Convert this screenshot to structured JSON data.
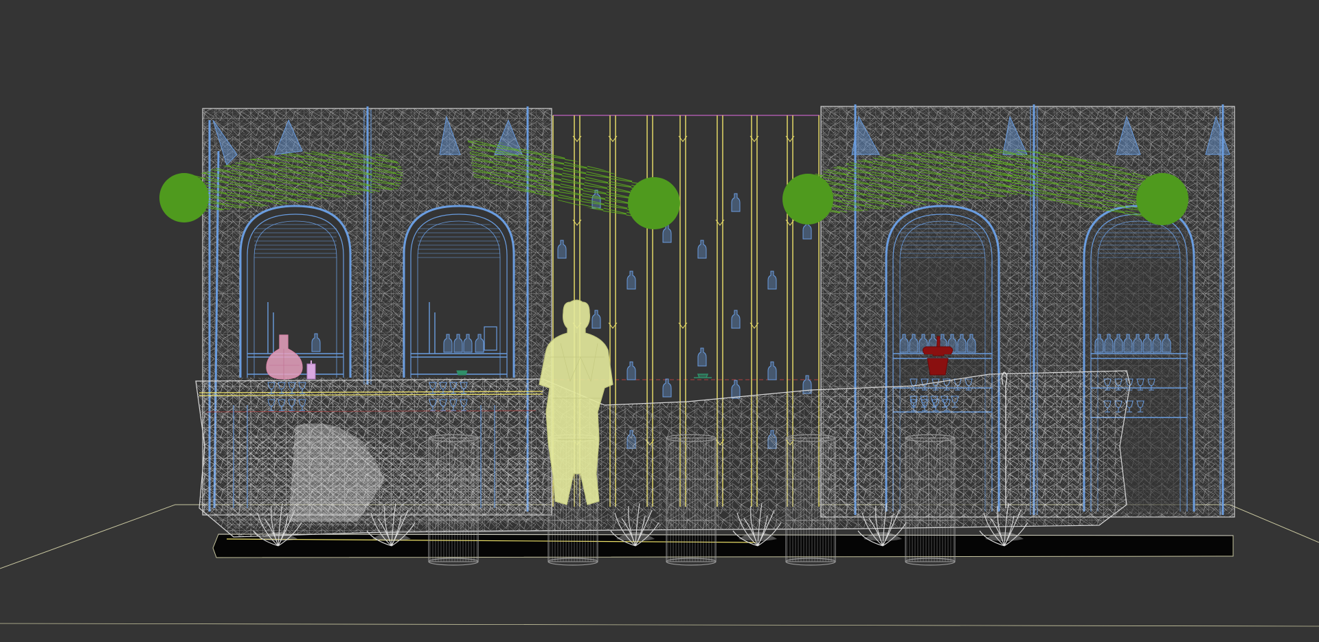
{
  "viewport": {
    "view": "front",
    "render_mode": "wireframe",
    "background_color": "#343434"
  },
  "palette": {
    "wire_white": "#dcdcdc",
    "wire_blue": "#6a9de0",
    "wire_yellow": "#f0e46a",
    "wire_green": "#4f9a1e",
    "wire_pink": "#e8a2c0",
    "wire_darkred": "#8a1010",
    "wire_teal": "#2f8f6a",
    "figure_yellow": "#e4ea9c",
    "magenta_line": "#c060c0",
    "grid_line": "#c9c7a0"
  },
  "scene_objects": [
    {
      "name": "left-wall-panel",
      "kind": "stone-wall",
      "color": "wire_white"
    },
    {
      "name": "right-wall-panel",
      "kind": "stone-wall",
      "color": "wire_white"
    },
    {
      "name": "center-bottle-rack",
      "kind": "rod-grid",
      "color": "wire_yellow"
    },
    {
      "name": "arched-shelf-1",
      "kind": "arch-niche",
      "color": "wire_blue"
    },
    {
      "name": "arched-shelf-2",
      "kind": "arch-niche",
      "color": "wire_blue"
    },
    {
      "name": "arched-shelf-3",
      "kind": "arch-niche",
      "color": "wire_blue"
    },
    {
      "name": "arched-shelf-4",
      "kind": "arch-niche",
      "color": "wire_blue"
    },
    {
      "name": "bar-counter",
      "kind": "counter",
      "color": "wire_white"
    },
    {
      "name": "standing-figure",
      "kind": "person",
      "color": "figure_yellow"
    },
    {
      "name": "bar-stools",
      "kind": "stool",
      "count": 5,
      "color": "wire_white"
    },
    {
      "name": "foliage-garlands",
      "kind": "plant",
      "count": 4,
      "color": "wire_green"
    },
    {
      "name": "floor-plant-tufts",
      "kind": "plant",
      "count": 6,
      "color": "wire_white"
    },
    {
      "name": "pink-vase",
      "kind": "vase",
      "color": "wire_pink"
    },
    {
      "name": "red-ice-bucket",
      "kind": "bucket",
      "color": "wire_darkred"
    },
    {
      "name": "ground-platform",
      "kind": "platform",
      "color": "#050505"
    }
  ]
}
